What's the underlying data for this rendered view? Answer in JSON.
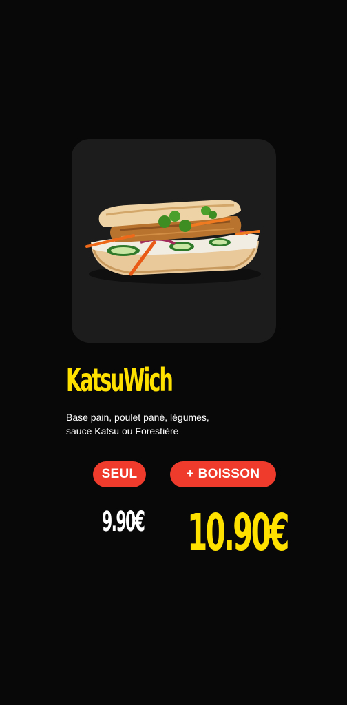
{
  "product": {
    "name": "KatsuWich",
    "description_line1": "Base pain, poulet pané, légumes,",
    "description_line2": "sauce Katsu ou Forestière",
    "image_icon": "sandwich-image"
  },
  "pricing": {
    "solo_label": "SEUL",
    "solo_price": "9.90€",
    "combo_label": "+ BOISSON",
    "combo_price": "10.90€"
  },
  "colors": {
    "background": "#080808",
    "card": "#1c1c1c",
    "accent_yellow": "#ffe100",
    "accent_red": "#ee3b2c"
  }
}
